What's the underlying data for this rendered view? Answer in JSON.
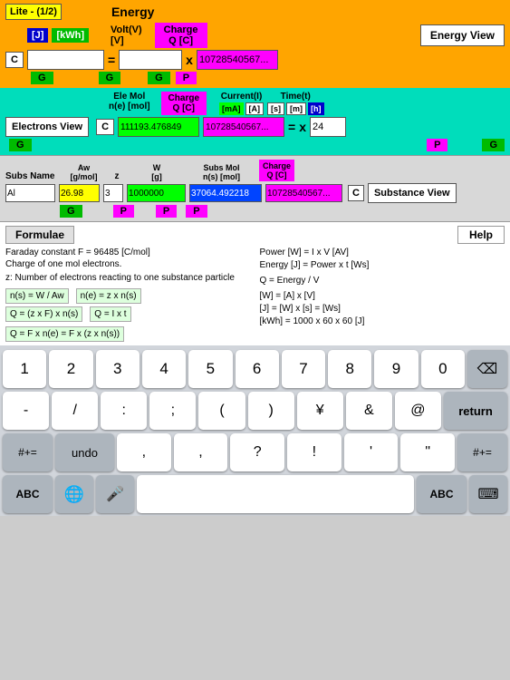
{
  "appTitle": "Lite - (1/2)",
  "topSection": {
    "energyLabel": "Energy",
    "voltLabel": "Volt(V)\n[V]",
    "chargeLabel": "Charge\nQ [C]",
    "jBtn": "[J]",
    "kwhBtn": "[kWh]",
    "inputValue1": "",
    "inputValue2": "",
    "inputValueGreen": "10728540567...",
    "energyViewBtn": "Energy View",
    "gBtn1": "G",
    "gBtn2": "G",
    "gBtn3": "G",
    "pBtn": "P"
  },
  "middleSection": {
    "electronsViewBtn": "Electrons View",
    "eleMolLabel": "Ele Mol\nn(e) [mol]",
    "chargeLabel": "Charge\nQ [C]",
    "currentLabel": "Current(I)",
    "timeLabel": "Time(t)",
    "mABtn": "[mA]",
    "aBtn": "[A]",
    "sBtn": "[s]",
    "mBtn": "[m]",
    "hBtn": "[h]",
    "cBtn": "C",
    "inputGreen": "111193.476849",
    "inputMagenta": "10728540567...",
    "inputTime": "24",
    "equalsSign": "=",
    "timesSign": "x",
    "gBtn1": "G",
    "gBtn2": "G",
    "pBtn": "P"
  },
  "substanceSection": {
    "subsName": "Subs Name",
    "awLabel": "Aw\n[g/mol]",
    "zLabel": "z",
    "wLabel": "W\n[g]",
    "subsMolLabel": "Subs Mol\nn(s) [mol]",
    "chargeLabel": "Charge\nQ [C]",
    "alLabel": "Al",
    "awValue": "26.98",
    "zValue": "3",
    "wValue": "1000000",
    "subsMolValue": "37064.492218",
    "chargeValue": "10728540567...",
    "cBtn": "C",
    "substanceViewBtn": "Substance View",
    "gBtn1": "G",
    "pBtn1": "P",
    "pBtn2": "P",
    "pBtn3": "P"
  },
  "formulaeSection": {
    "title": "Formulae",
    "helpBtn": "Help",
    "line1": "Faraday constant  F = 96485 [C/mol]",
    "line2": "Charge of one mol electrons.",
    "line3": "z: Number of electrons reacting to one substance particle",
    "formula1": "n(s) = W / Aw",
    "formula2": "Q = (z x F) x n(s)",
    "formula3": "n(e) = z x n(s)",
    "formula4": "Q = I x t",
    "formula5": "Q = F x n(e) = F x (z x n(s))",
    "right1": "Power [W] = I x V  [AV]",
    "right2": "Energy [J] =  Power x t  [Ws]",
    "right3": "Q = Energy  / V",
    "right4": "[W] = [A] x [V]",
    "right5": "[J] = [W] x [s] = [Ws]",
    "right6": "[kWh] = 1000 x 60 x 60 [J]"
  },
  "keyboard": {
    "row1": [
      "1",
      "2",
      "3",
      "4",
      "5",
      "6",
      "7",
      "8",
      "9",
      "0"
    ],
    "row2": [
      "-",
      "/",
      ":",
      ";",
      "(",
      ")",
      "¥",
      "&",
      "@"
    ],
    "row3_left": "#+=",
    "row3_mid": [
      "undo",
      ",",
      ",",
      "?",
      "!",
      "'",
      "\""
    ],
    "row3_right": "#+=",
    "bottomLeft": "ABC",
    "bottomGlobe": "🌐",
    "bottomMic": "🎤",
    "bottomABC": "ABC",
    "returnLabel": "return",
    "deleteLabel": "⌫",
    "kbdIcon": "⌨"
  }
}
